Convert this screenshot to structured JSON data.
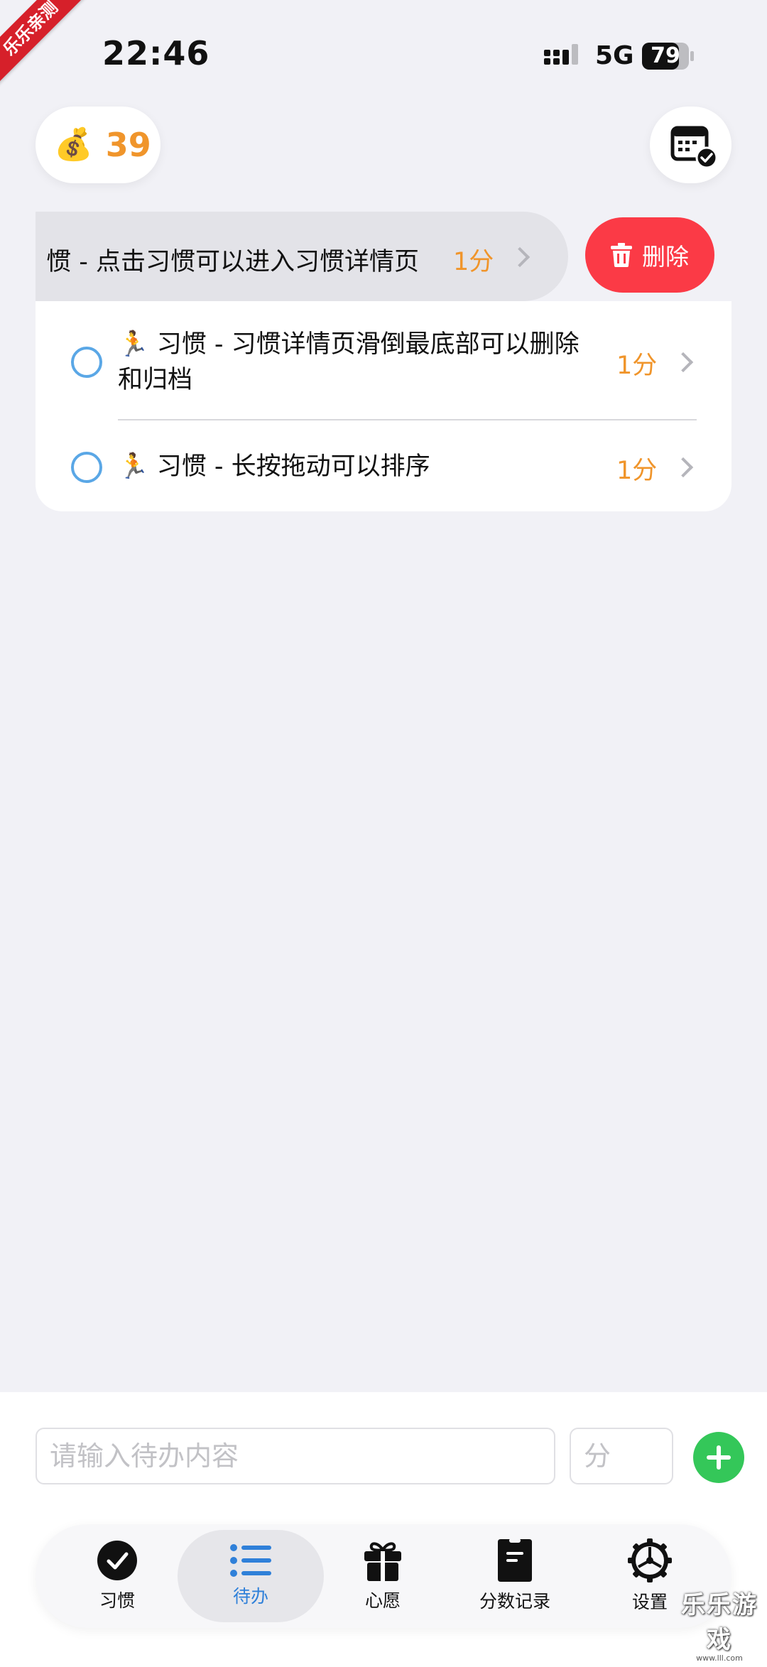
{
  "corner_ribbon": "乐乐亲测",
  "status_bar": {
    "time": "22:46",
    "network": "5G",
    "battery": "79"
  },
  "header": {
    "coins_icon": "money-bag",
    "coins": "39",
    "calendar_icon": "calendar-check"
  },
  "todo_list": {
    "swiped_item": {
      "text": "惯 - 点击习惯可以进入习惯详情页",
      "points": "1分",
      "delete_label": "删除"
    },
    "items": [
      {
        "emoji": "🏃",
        "text": "习惯 - 习惯详情页滑倒最底部可以删除",
        "text_line2": "和归档",
        "points": "1分"
      },
      {
        "emoji": "🏃",
        "text": "习惯 - 长按拖动可以排序",
        "points": "1分"
      }
    ]
  },
  "input_bar": {
    "content_placeholder": "请输入待办内容",
    "points_placeholder": "分"
  },
  "tabs": [
    {
      "label": "习惯",
      "icon": "check-circle"
    },
    {
      "label": "待办",
      "icon": "list"
    },
    {
      "label": "心愿",
      "icon": "gift"
    },
    {
      "label": "分数记录",
      "icon": "receipt"
    },
    {
      "label": "设置",
      "icon": "gear"
    }
  ],
  "active_tab": "待办",
  "colors": {
    "accent": "#2f80d9",
    "points": "#f0952b",
    "delete": "#fb3a46",
    "add": "#34c759"
  },
  "watermark": {
    "title": "乐乐游戏",
    "url": "www.lll.com"
  }
}
